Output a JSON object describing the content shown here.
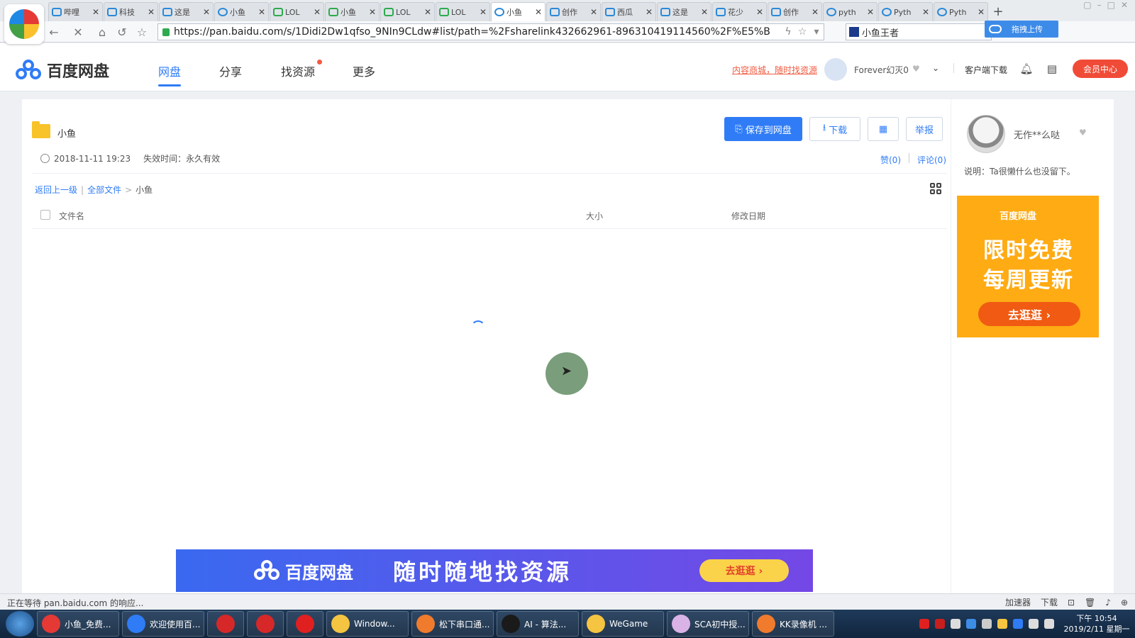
{
  "browser": {
    "tabs": [
      {
        "label": "哔哩",
        "icon": "bilibili-icon"
      },
      {
        "label": "科技",
        "icon": "bilibili-icon"
      },
      {
        "label": "这是",
        "icon": "bilibili-icon"
      },
      {
        "label": "小鱼",
        "icon": "baidu-paw-icon"
      },
      {
        "label": "LOL",
        "icon": "green-book-icon"
      },
      {
        "label": "小鱼",
        "icon": "green-book-icon"
      },
      {
        "label": "LOL",
        "icon": "green-book-icon"
      },
      {
        "label": "LOL",
        "icon": "green-book-icon"
      },
      {
        "label": "小鱼",
        "icon": "baidu-netdisk-icon",
        "active": true
      },
      {
        "label": "创作",
        "icon": "bilibili-icon"
      },
      {
        "label": "西瓜",
        "icon": "bilibili-icon"
      },
      {
        "label": "这是",
        "icon": "bilibili-icon"
      },
      {
        "label": "花少",
        "icon": "bilibili-icon"
      },
      {
        "label": "创作",
        "icon": "bilibili-icon"
      },
      {
        "label": "pyth",
        "icon": "baidu-paw-icon"
      },
      {
        "label": "Pyth",
        "icon": "baidu-netdisk-icon"
      },
      {
        "label": "Pyth",
        "icon": "baidu-netdisk-icon"
      }
    ],
    "new_tab": "+",
    "url": "https://pan.baidu.com/s/1Didi2Dw1qfso_9NIn9CLdw#list/path=%2Fsharelink432662961-896310419114560%2F%E5%B",
    "search_value": "小鱼王者",
    "drag_upload_label": "拖拽上传",
    "status_text": "正在等待 pan.baidu.com 的响应...",
    "status_right": [
      "加速器",
      "下载"
    ]
  },
  "header": {
    "brand": "百度网盘",
    "nav": [
      "网盘",
      "分享",
      "找资源",
      "更多"
    ],
    "active_nav": "网盘",
    "promo_link": "内容商城，随时找资源",
    "username": "Forever幻灭0",
    "client_download": "客户端下载",
    "vip_label": "会员中心",
    "accent": "#2f7cf6",
    "vip_color": "#f04b37"
  },
  "share": {
    "folder_name": "小鱼",
    "date": "2018-11-11 19:23",
    "expire": "失效时间：永久有效",
    "save_label": "保存到网盘",
    "download_label": "下载",
    "report_label": "举报",
    "likes": "赞(0)",
    "comments": "评论(0)",
    "breadcrumb": {
      "back": "返回上一级",
      "all": "全部文件",
      "sep": ">",
      "current": "小鱼"
    },
    "columns": {
      "name": "文件名",
      "size": "大小",
      "date": "修改日期"
    }
  },
  "sharer": {
    "name": "无作**么哒",
    "desc": "说明：Ta很懒什么也没留下。"
  },
  "side_ad": {
    "brand": "百度网盘",
    "line1": "限时免费",
    "line2": "每周更新",
    "button": "去逛逛 ›"
  },
  "bottom_ad": {
    "brand": "百度网盘",
    "slogan": "随时随地找资源",
    "button": "去逛逛 ›"
  },
  "taskbar": {
    "items": [
      {
        "label": "小鱼_免费...",
        "color": "#e53935"
      },
      {
        "label": "欢迎使用百...",
        "color": "#2f7cf6"
      },
      {
        "label": "",
        "color": "#d62828"
      },
      {
        "label": "",
        "color": "#d62828"
      },
      {
        "label": "",
        "color": "#e02020"
      },
      {
        "label": "Window...",
        "color": "#f5c542"
      },
      {
        "label": "松下串口通...",
        "color": "#f07b2c"
      },
      {
        "label": "AI - 算法...",
        "color": "#1a1a1a"
      },
      {
        "label": "WeGame",
        "color": "#f5c542"
      },
      {
        "label": "SCA初中授...",
        "color": "#d9b3e6"
      },
      {
        "label": "KK录像机 ...",
        "color": "#f07b2c"
      }
    ],
    "time": "下午 10:54",
    "date": "2019/2/11 星期一"
  }
}
